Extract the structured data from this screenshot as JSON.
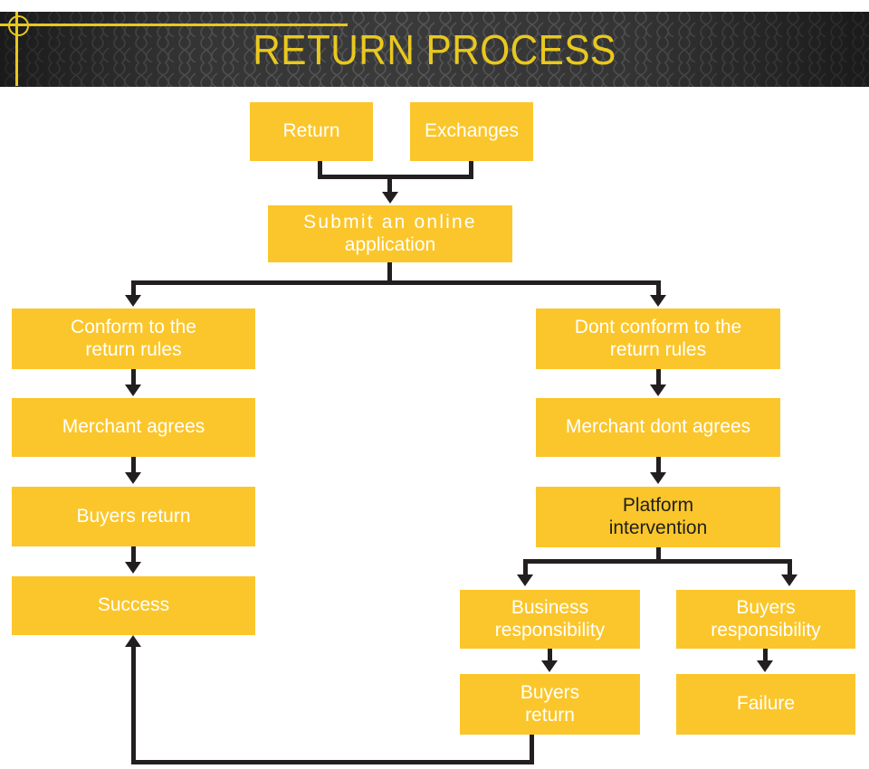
{
  "header": {
    "title": "RETURN PROCESS",
    "title_color": "#e9c81f",
    "background_color": "#3a3a3a",
    "decoration": {
      "circle": "circle-outline-marker",
      "horizontal_rule": "yellow-horizontal-rule",
      "vertical_rule": "yellow-vertical-rule"
    }
  },
  "theme": {
    "box_color": "#fbc62b",
    "box_text_color": "#ffffff",
    "box_text_color_alt": "#1f1f1f",
    "connector_color": "#231f20",
    "page_background": "#ffffff"
  },
  "chart_data": {
    "type": "diagram",
    "title": "RETURN PROCESS",
    "nodes": [
      {
        "id": "return",
        "label": "Return",
        "line1": "Return",
        "line2": "",
        "text_color": "#ffffff"
      },
      {
        "id": "exchanges",
        "label": "Exchanges",
        "line1": "Exchanges",
        "line2": "",
        "text_color": "#ffffff"
      },
      {
        "id": "submit",
        "label": "Submit an online application",
        "line1": "Submit an online",
        "line2": "application",
        "text_color": "#ffffff"
      },
      {
        "id": "conform",
        "label": "Conform to the return rules",
        "line1": "Conform to the",
        "line2": "return rules",
        "text_color": "#ffffff"
      },
      {
        "id": "dont-conform",
        "label": "Dont conform to the return rules",
        "line1": "Dont conform to the",
        "line2": "return rules",
        "text_color": "#ffffff"
      },
      {
        "id": "merchant-agrees",
        "label": "Merchant agrees",
        "line1": "Merchant agrees",
        "line2": "",
        "text_color": "#ffffff"
      },
      {
        "id": "merchant-dont-agrees",
        "label": "Merchant dont agrees",
        "line1": "Merchant dont agrees",
        "line2": "",
        "text_color": "#ffffff"
      },
      {
        "id": "buyers-return-left",
        "label": "Buyers return",
        "line1": "Buyers return",
        "line2": "",
        "text_color": "#ffffff"
      },
      {
        "id": "platform",
        "label": "Platform intervention",
        "line1": "Platform",
        "line2": "intervention",
        "text_color": "#1f1f1f"
      },
      {
        "id": "success",
        "label": "Success",
        "line1": "Success",
        "line2": "",
        "text_color": "#ffffff"
      },
      {
        "id": "business-resp",
        "label": "Business responsibility",
        "line1": "Business",
        "line2": "responsibility",
        "text_color": "#ffffff"
      },
      {
        "id": "buyers-resp",
        "label": "Buyers responsibility",
        "line1": "Buyers",
        "line2": "responsibility",
        "text_color": "#ffffff"
      },
      {
        "id": "buyers-return-right",
        "label": "Buyers return",
        "line1": "Buyers",
        "line2": "return",
        "text_color": "#ffffff"
      },
      {
        "id": "failure",
        "label": "Failure",
        "line1": "Failure",
        "line2": "",
        "text_color": "#ffffff"
      }
    ],
    "edges": [
      {
        "from": "return",
        "to": "submit"
      },
      {
        "from": "exchanges",
        "to": "submit"
      },
      {
        "from": "submit",
        "to": "conform"
      },
      {
        "from": "submit",
        "to": "dont-conform"
      },
      {
        "from": "conform",
        "to": "merchant-agrees"
      },
      {
        "from": "merchant-agrees",
        "to": "buyers-return-left"
      },
      {
        "from": "buyers-return-left",
        "to": "success"
      },
      {
        "from": "dont-conform",
        "to": "merchant-dont-agrees"
      },
      {
        "from": "merchant-dont-agrees",
        "to": "platform"
      },
      {
        "from": "platform",
        "to": "business-resp"
      },
      {
        "from": "platform",
        "to": "buyers-resp"
      },
      {
        "from": "business-resp",
        "to": "buyers-return-right"
      },
      {
        "from": "buyers-resp",
        "to": "failure"
      },
      {
        "from": "buyers-return-right",
        "to": "success"
      }
    ]
  }
}
